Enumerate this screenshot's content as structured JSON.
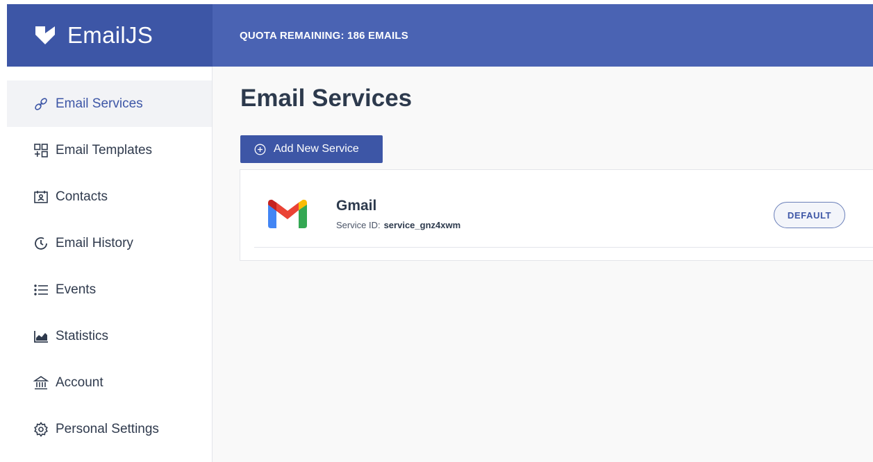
{
  "app": {
    "name": "EmailJS",
    "brand_color": "#4a63b3",
    "brand_dark": "#3d56a6"
  },
  "header": {
    "quota_text": "QUOTA REMAINING: 186 EMAILS"
  },
  "sidebar": {
    "items": [
      {
        "label": "Email Services",
        "icon": "link-icon",
        "active": true
      },
      {
        "label": "Email Templates",
        "icon": "templates-icon",
        "active": false
      },
      {
        "label": "Contacts",
        "icon": "contacts-icon",
        "active": false
      },
      {
        "label": "Email History",
        "icon": "history-icon",
        "active": false
      },
      {
        "label": "Events",
        "icon": "list-icon",
        "active": false
      },
      {
        "label": "Statistics",
        "icon": "chart-icon",
        "active": false
      },
      {
        "label": "Account",
        "icon": "bank-icon",
        "active": false
      },
      {
        "label": "Personal Settings",
        "icon": "gear-icon",
        "active": false
      }
    ]
  },
  "main": {
    "title": "Email Services",
    "add_button_label": "Add New Service",
    "services": [
      {
        "name": "Gmail",
        "service_id_label": "Service ID:",
        "service_id": "service_gnz4xwm",
        "badge": "DEFAULT"
      }
    ]
  }
}
